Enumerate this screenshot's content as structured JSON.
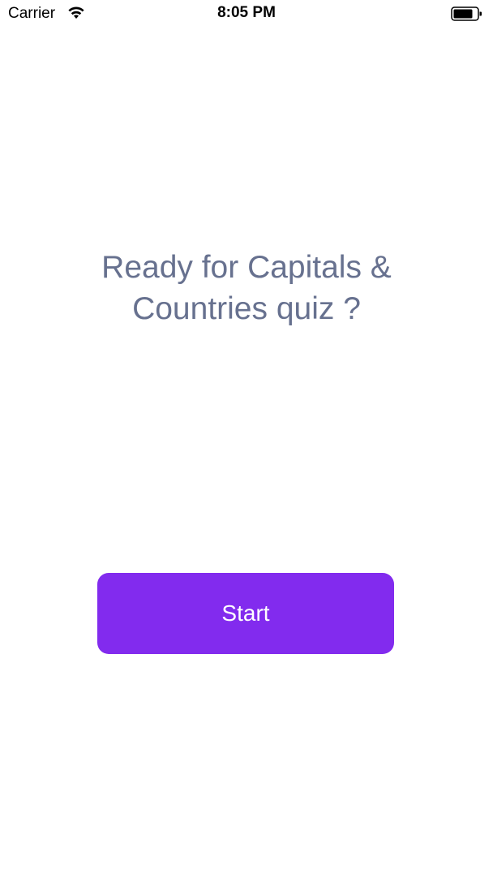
{
  "status_bar": {
    "carrier": "Carrier",
    "time": "8:05 PM",
    "wifi_icon": "wifi-icon",
    "battery_icon": "battery-icon"
  },
  "main": {
    "title_line1": "Ready for Capitals &",
    "title_line2": "Countries quiz ?",
    "start_label": "Start"
  },
  "colors": {
    "title": "#67718f",
    "button": "#822bee",
    "button_text": "#ffffff",
    "background": "#ffffff"
  }
}
